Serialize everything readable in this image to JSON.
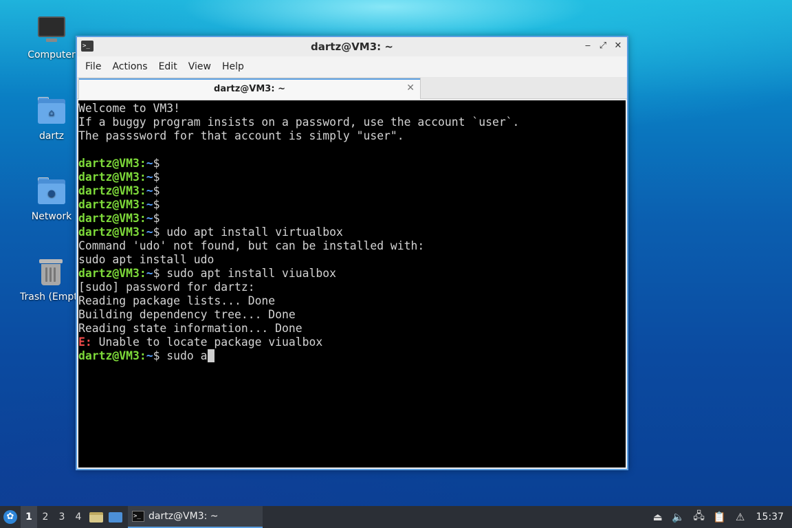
{
  "desktop": {
    "icons": [
      {
        "label": "Computer"
      },
      {
        "label": "dartz"
      },
      {
        "label": "Network"
      },
      {
        "label": "Trash (Empty)"
      }
    ]
  },
  "window": {
    "title": "dartz@VM3: ~",
    "menu": [
      "File",
      "Actions",
      "Edit",
      "View",
      "Help"
    ],
    "tab": {
      "label": "dartz@VM3: ~"
    },
    "terminal": {
      "prompt_user": "dartz@VM3",
      "prompt_sep": ":",
      "prompt_path": "~",
      "prompt_sym": "$",
      "lines": [
        {
          "type": "text",
          "text": "Welcome to VM3!"
        },
        {
          "type": "text",
          "text": "If a buggy program insists on a password, use the account `user`."
        },
        {
          "type": "text",
          "text": "The passsword for that account is simply \"user\"."
        },
        {
          "type": "text",
          "text": ""
        },
        {
          "type": "prompt",
          "cmd": ""
        },
        {
          "type": "prompt",
          "cmd": ""
        },
        {
          "type": "prompt",
          "cmd": ""
        },
        {
          "type": "prompt",
          "cmd": ""
        },
        {
          "type": "prompt",
          "cmd": ""
        },
        {
          "type": "prompt",
          "cmd": " udo apt install virtualbox"
        },
        {
          "type": "text",
          "text": "Command 'udo' not found, but can be installed with:"
        },
        {
          "type": "text",
          "text": "sudo apt install udo"
        },
        {
          "type": "prompt",
          "cmd": " sudo apt install viualbox"
        },
        {
          "type": "text",
          "text": "[sudo] password for dartz:"
        },
        {
          "type": "text",
          "text": "Reading package lists... Done"
        },
        {
          "type": "text",
          "text": "Building dependency tree... Done"
        },
        {
          "type": "text",
          "text": "Reading state information... Done"
        },
        {
          "type": "error",
          "prefix": "E:",
          "text": " Unable to locate package viualbox"
        },
        {
          "type": "prompt",
          "cmd": " sudo a",
          "cursor": true
        }
      ]
    }
  },
  "taskbar": {
    "workspaces": [
      "1",
      "2",
      "3",
      "4"
    ],
    "active_workspace": "1",
    "task_label": "dartz@VM3: ~",
    "clock": "15:37"
  },
  "colors": {
    "prompt": "#7edb3a",
    "path": "#5aa2ff",
    "error": "#f04a4a",
    "accent": "#5a9fe2"
  }
}
